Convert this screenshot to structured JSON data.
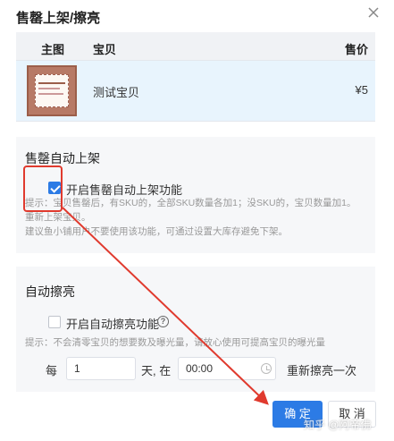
{
  "dialog": {
    "title": "售罄上架/擦亮"
  },
  "table": {
    "headers": {
      "image": "主图",
      "item": "宝贝",
      "price": "售价"
    },
    "rows": [
      {
        "name": "测试宝贝",
        "price": "¥5"
      }
    ]
  },
  "auto_relist": {
    "title": "售罄自动上架",
    "checkbox_label": "开启售罄自动上架功能",
    "checked": true,
    "hint_line1": "提示：宝贝售罄后，有SKU的，全部SKU数量各加1；没SKU的，宝贝数量加1。",
    "hint_line2": "重新上架宝贝。",
    "hint_line3": "建议鱼小铺用户不要使用该功能，可通过设置大库存避免下架。"
  },
  "auto_polish": {
    "title": "自动擦亮",
    "checkbox_label": "开启自动擦亮功能",
    "checked": false,
    "hint": "提示：不会清零宝贝的想要数及曝光量，请放心使用可提高宝贝的曝光量",
    "every_label": "每",
    "days_value": "1",
    "days_unit_label": "天, 在",
    "time_value": "00:00",
    "repeat_label": "重新擦亮一次"
  },
  "buttons": {
    "confirm": "确 定",
    "cancel": "取 消"
  },
  "watermark": "知乎 @阿帝佛",
  "colors": {
    "primary": "#2c7be5",
    "annotation_red": "#e03a2e"
  }
}
